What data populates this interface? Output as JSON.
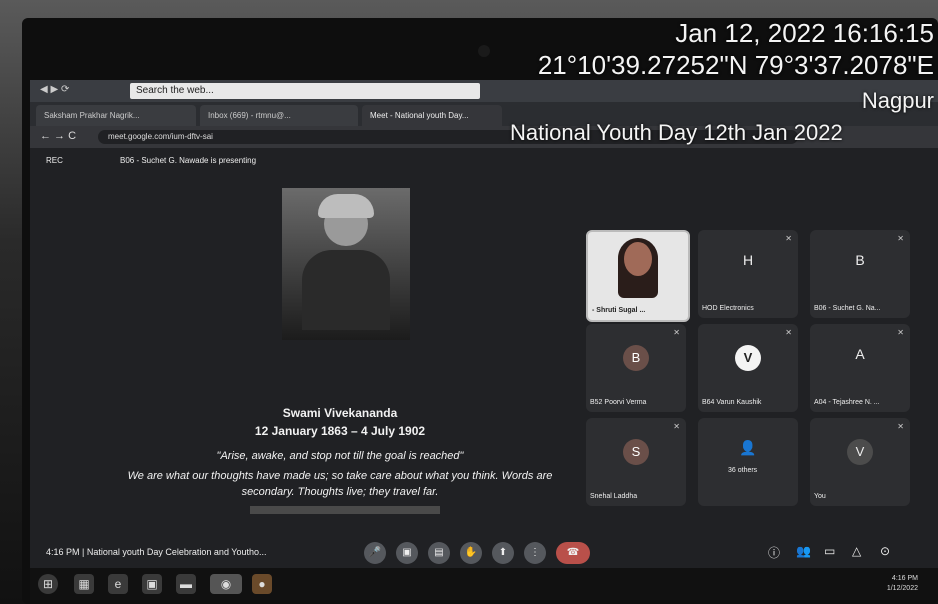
{
  "overlay": {
    "datetime": "Jan 12, 2022 16:16:15",
    "coordinates": "21°10'39.27252\"N 79°3'37.2078\"E",
    "city": "Nagpur",
    "event": "National Youth Day 12th Jan 2022"
  },
  "browser": {
    "search_placeholder": "Search the web...",
    "tabs": [
      "Saksham Prakhar Nagrik...",
      "Inbox (669) - rtmnu@...",
      "Meet - National youth Day..."
    ],
    "url": "meet.google.com/ium-dftv-sai"
  },
  "meet": {
    "rec": "REC",
    "presenting": "B06 - Suchet G. Nawade is presenting",
    "slide": {
      "name": "Swami Vivekananda",
      "dates": "12 January 1863 – 4 July 1902",
      "quote1": "\"Arise, awake, and stop not till the goal is reached\"",
      "quote2": "We are what our thoughts have made us; so take care about what you think. Words are",
      "quote3": "secondary. Thoughts live; they travel far."
    },
    "tiles": [
      {
        "letter": "",
        "name": "- Shruti Sugal ..."
      },
      {
        "letter": "H",
        "name": "HOD Electronics"
      },
      {
        "letter": "B",
        "name": "B06 - Suchet G. Na..."
      },
      {
        "letter": "B",
        "name": "B52 Poorvi Verma"
      },
      {
        "letter": "V",
        "name": "B64 Varun Kaushik"
      },
      {
        "letter": "A",
        "name": "A04 - Tejashree N. ..."
      },
      {
        "letter": "S",
        "name": "Snehal Laddha"
      },
      {
        "letter": "",
        "name": "36 others"
      },
      {
        "letter": "V",
        "name": "You"
      }
    ],
    "meeting_label": "4:16 PM | National youth Day Celebration and Youtho..."
  },
  "taskbar": {
    "time": "4:16 PM",
    "date": "1/12/2022"
  },
  "colors": {
    "meet_bg": "#202124",
    "end_call": "#b9504a"
  }
}
